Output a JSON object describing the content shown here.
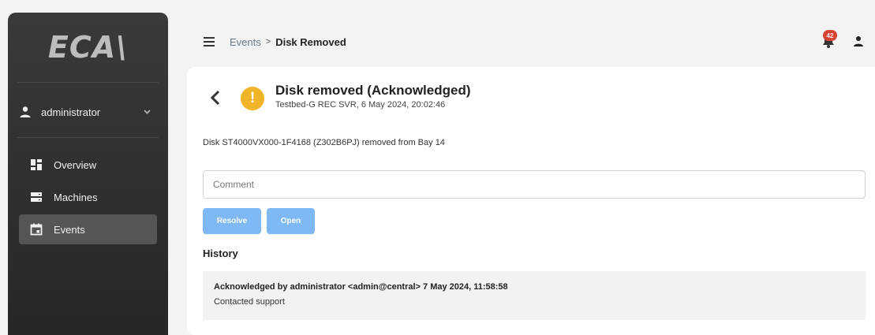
{
  "sidebar": {
    "logo": "ECA\\",
    "user": {
      "name": "administrator"
    },
    "items": [
      {
        "label": "Overview",
        "icon": "dashboard-icon"
      },
      {
        "label": "Machines",
        "icon": "server-icon"
      },
      {
        "label": "Events",
        "icon": "calendar-icon",
        "active": true
      }
    ]
  },
  "header": {
    "breadcrumb": {
      "parent": "Events",
      "separator": ">",
      "current": "Disk Removed"
    },
    "notifications_count": "42"
  },
  "event": {
    "title": "Disk removed (Acknowledged)",
    "subtitle": "Testbed-G REC SVR, 6 May 2024, 20:02:46",
    "severity_icon": "!",
    "severity_color": "#f0b429",
    "description": "Disk ST4000VX000-1F4168 (Z302B6PJ) removed from Bay 14",
    "comment_placeholder": "Comment",
    "resolve_label": "Resolve",
    "open_label": "Open"
  },
  "history": {
    "title": "History",
    "entries": [
      {
        "header": "Acknowledged by administrator <admin@central>  7 May 2024, 11:58:58",
        "comment": "Contacted support"
      }
    ]
  },
  "colors": {
    "accent_button": "#7eb8f5",
    "badge": "#d94433",
    "sidebar_active": "#555555"
  }
}
